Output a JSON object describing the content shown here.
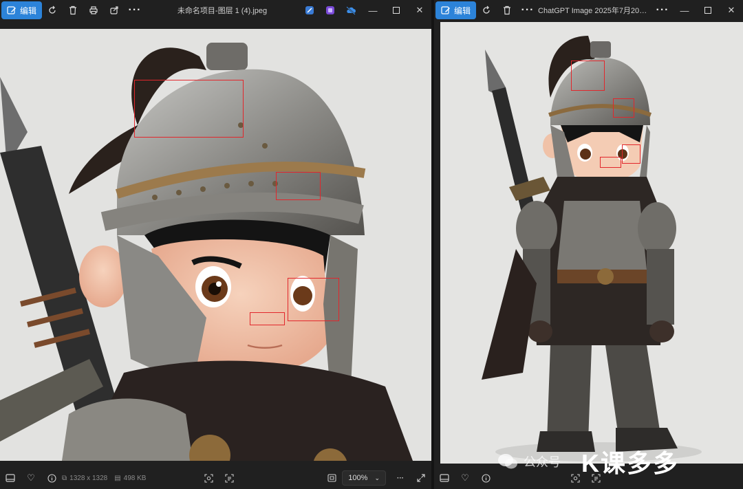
{
  "left_window": {
    "edit_label": "编辑",
    "title": "未命名项目-图层 1 (4).jpeg",
    "image_size": "1328 x 1328",
    "file_size": "498 KB",
    "zoom": "100%"
  },
  "right_window": {
    "edit_label": "编辑",
    "title": "ChatGPT Image 2025年7月20日..."
  },
  "watermark": {
    "account_text": "公众号",
    "logo_text": "K课多多"
  },
  "colors": {
    "accent": "#2c83d9",
    "highlight_box": "#e2262b",
    "background": "#202020"
  },
  "icons": [
    "edit-icon",
    "rotate-icon",
    "delete-icon",
    "print-icon",
    "share-icon",
    "more-icon",
    "minimize-icon",
    "maximize-icon",
    "close-icon",
    "favorite-icon",
    "info-icon",
    "fit-icon",
    "expand-icon"
  ]
}
